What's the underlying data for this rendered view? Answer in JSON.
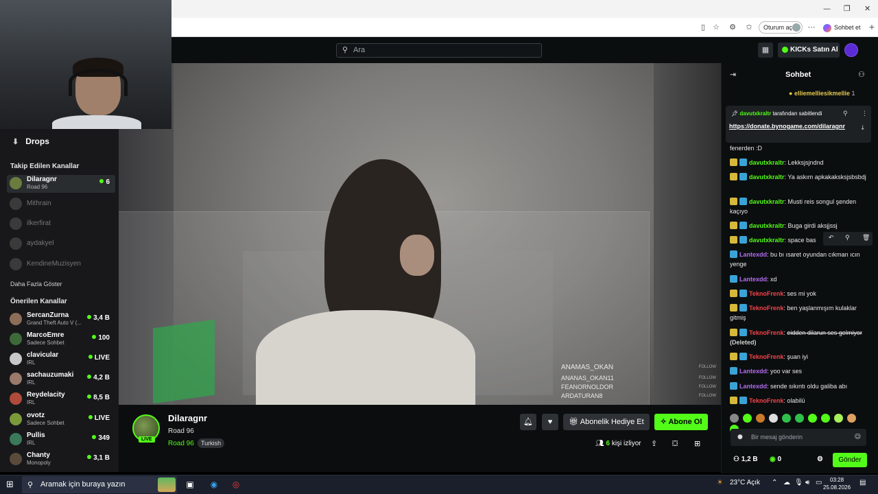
{
  "browser": {
    "signin_label": "Oturum aç",
    "copilot_label": "Sohbet et"
  },
  "topnav": {
    "search_placeholder": "Ara",
    "kicks_button": "KICKs Satın Al"
  },
  "sidebar": {
    "drops_label": "Drops",
    "followed_heading": "Takip Edilen Kanallar",
    "followed": [
      {
        "name": "Dilaragnr",
        "category": "Road 96",
        "viewers": "6",
        "live": true
      },
      {
        "name": "Mithrain",
        "live": false
      },
      {
        "name": "ilkerfirat",
        "live": false
      },
      {
        "name": "aydakyel",
        "live": false
      },
      {
        "name": "KendineMuzisyen",
        "live": false
      }
    ],
    "show_more": "Daha Fazla Göster",
    "recommended_heading": "Önerilen Kanallar",
    "recommended": [
      {
        "name": "SercanZurna",
        "category": "Grand Theft Auto V (...",
        "viewers": "3,4 B"
      },
      {
        "name": "MarcoEmre",
        "category": "Sadece Sohbet",
        "viewers": "100"
      },
      {
        "name": "clavicular",
        "category": "IRL",
        "viewers": "LIVE"
      },
      {
        "name": "sachauzumaki",
        "category": "IRL",
        "viewers": "4,2 B"
      },
      {
        "name": "Reydelacity",
        "category": "IRL",
        "viewers": "8,5 B"
      },
      {
        "name": "ovotz",
        "category": "Sadece Sohbet",
        "viewers": "LIVE"
      },
      {
        "name": "Pullis",
        "category": "IRL",
        "viewers": "349"
      },
      {
        "name": "Chanty",
        "category": "Monopoly",
        "viewers": "3,1 B"
      }
    ]
  },
  "video_overlay": {
    "ghost_chat": [
      {
        "name": "ANAMAS_OKAN",
        "tag": "FOLLOW"
      },
      {
        "name": "ANANAS_OKAN11",
        "tag": "FOLLOW"
      },
      {
        "name": "FEANORNOLDOR",
        "tag": "FOLLOW"
      },
      {
        "name": "ARDATURAN8",
        "tag": "FOLLOW"
      }
    ]
  },
  "stream": {
    "streamer": "Dilaragnr",
    "category": "Road 96",
    "category_link": "Road 96",
    "language_tag": "Turkish",
    "live_badge": "LIVE",
    "gift_sub_button": "Abonelik Hediye Et",
    "subscribe_button": "Abone Ol",
    "viewers_count": "6",
    "viewers_suffix": "kişi izliyor"
  },
  "chat": {
    "title": "Sohbet",
    "gifted_user": "elliemelliesikmellie",
    "gifted_count": "1",
    "pinned": {
      "pinned_by_user": "davutxkraltr",
      "pinned_by_suffix": "tarafından sabitlendi",
      "link": "https://donate.bynogame.com/dilaragnr"
    },
    "messages": [
      {
        "user": "",
        "text": "fenerden :D",
        "badges": 0,
        "color": "#ffffff"
      },
      {
        "user": "davutxkraltr",
        "text": "Lekksjsjndnd",
        "badges": 2,
        "color": "#53fc18"
      },
      {
        "user": "davutxkraltr",
        "text": "Ya askım apkakaksksjsbsbdj",
        "badges": 2,
        "color": "#53fc18"
      },
      {
        "user": "davutxkraltr",
        "text": "Musti reis songul şenden kaçıyo",
        "badges": 2,
        "color": "#53fc18"
      },
      {
        "user": "davutxkraltr",
        "text": "Buga girdi aksjjssj",
        "badges": 2,
        "color": "#53fc18"
      },
      {
        "user": "davutxkraltr",
        "text": "space bas",
        "badges": 2,
        "color": "#53fc18"
      },
      {
        "user": "Lantexdd",
        "text": "bu bı ısaret oyundan cıkman ıcın yenge",
        "badges": 1,
        "color": "#b36cf0"
      },
      {
        "user": "Lantexdd",
        "text": "xd",
        "badges": 1,
        "color": "#b36cf0"
      },
      {
        "user": "TeknoFrenk",
        "text": "ses mi yok",
        "badges": 2,
        "color": "#f5424b"
      },
      {
        "user": "TeknoFrenk",
        "text": "ben yaşlanmışım kulaklar gitmiş",
        "badges": 2,
        "color": "#f5424b"
      },
      {
        "user": "TeknoFrenk",
        "text": "eidden dilarun ses gelmiyor",
        "deleted_label": "(Deleted)",
        "badges": 2,
        "color": "#f5424b",
        "deleted": true
      },
      {
        "user": "TeknoFrenk",
        "text": "şuan iyi",
        "badges": 2,
        "color": "#f5424b"
      },
      {
        "user": "Lantexdd",
        "text": "yoo var ses",
        "badges": 1,
        "color": "#b36cf0"
      },
      {
        "user": "Lantexdd",
        "text": "sende sıkıntı oldu galiba abı",
        "badges": 1,
        "color": "#b36cf0"
      },
      {
        "user": "TeknoFrenk",
        "text": "olabilü",
        "badges": 2,
        "color": "#f5424b"
      }
    ],
    "input_placeholder": "Bir mesaj gönderin",
    "followers_count": "1,2 B",
    "kicks_count": "0",
    "send_button": "Gönder"
  },
  "taskbar": {
    "search_placeholder": "Aramak için buraya yazın",
    "weather": "23°C  Açık",
    "time": "03:28",
    "date": "25.08.2026"
  },
  "colors": {
    "kick_green": "#53fc18",
    "background": "#0b0e0f",
    "sidebar": "#18181b"
  }
}
